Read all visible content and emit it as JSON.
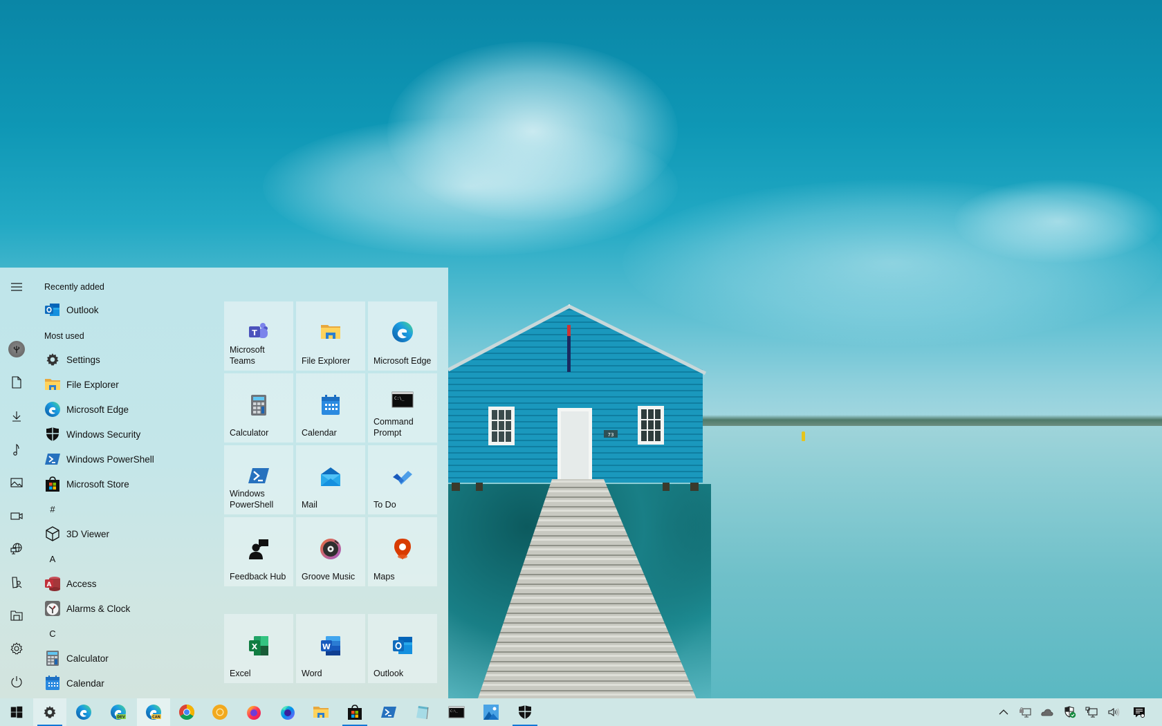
{
  "start_menu": {
    "rail": [
      {
        "name": "expand",
        "icon": "hamburger-icon"
      },
      {
        "name": "account",
        "icon": "avatar"
      },
      {
        "name": "documents",
        "icon": "document-icon"
      },
      {
        "name": "downloads",
        "icon": "download-icon"
      },
      {
        "name": "music",
        "icon": "music-note-icon"
      },
      {
        "name": "pictures",
        "icon": "picture-icon"
      },
      {
        "name": "videos",
        "icon": "video-icon"
      },
      {
        "name": "network",
        "icon": "network-globe-icon"
      },
      {
        "name": "personal-folder",
        "icon": "personal-folder-icon"
      },
      {
        "name": "file-explorer",
        "icon": "file-explorer-icon"
      },
      {
        "name": "settings",
        "icon": "gear-icon"
      },
      {
        "name": "power",
        "icon": "power-icon"
      }
    ],
    "app_list": {
      "recently_added_header": "Recently added",
      "recently_added": [
        {
          "label": "Outlook",
          "icon": "outlook-icon"
        }
      ],
      "most_used_header": "Most used",
      "most_used": [
        {
          "label": "Settings",
          "icon": "gear-icon"
        },
        {
          "label": "File Explorer",
          "icon": "file-explorer-icon"
        },
        {
          "label": "Microsoft Edge",
          "icon": "edge-icon"
        },
        {
          "label": "Windows Security",
          "icon": "shield-icon"
        },
        {
          "label": "Windows PowerShell",
          "icon": "powershell-icon"
        },
        {
          "label": "Microsoft Store",
          "icon": "store-icon"
        }
      ],
      "sections": [
        {
          "letter": "#",
          "items": [
            {
              "label": "3D Viewer",
              "icon": "cube-icon"
            }
          ]
        },
        {
          "letter": "A",
          "items": [
            {
              "label": "Access",
              "icon": "access-icon"
            },
            {
              "label": "Alarms & Clock",
              "icon": "clock-icon"
            }
          ]
        },
        {
          "letter": "C",
          "items": [
            {
              "label": "Calculator",
              "icon": "calculator-icon"
            },
            {
              "label": "Calendar",
              "icon": "calendar-icon"
            }
          ]
        }
      ]
    },
    "tiles": {
      "group1": [
        {
          "label": "Microsoft Teams",
          "icon": "teams-icon"
        },
        {
          "label": "File Explorer",
          "icon": "file-explorer-icon"
        },
        {
          "label": "Microsoft Edge",
          "icon": "edge-icon"
        },
        {
          "label": "Calculator",
          "icon": "calculator-icon"
        },
        {
          "label": "Calendar",
          "icon": "calendar-icon"
        },
        {
          "label": "Command Prompt",
          "icon": "command-prompt-icon"
        },
        {
          "label": "Windows PowerShell",
          "icon": "powershell-icon"
        },
        {
          "label": "Mail",
          "icon": "mail-icon"
        },
        {
          "label": "To Do",
          "icon": "todo-check-icon"
        },
        {
          "label": "Feedback Hub",
          "icon": "feedback-hub-icon"
        },
        {
          "label": "Groove Music",
          "icon": "groove-music-icon"
        },
        {
          "label": "Maps",
          "icon": "maps-pin-icon"
        }
      ],
      "group2": [
        {
          "label": "Excel",
          "icon": "excel-icon"
        },
        {
          "label": "Word",
          "icon": "word-icon"
        },
        {
          "label": "Outlook",
          "icon": "outlook-icon"
        }
      ]
    }
  },
  "taskbar": {
    "start_button": "windows-logo-icon",
    "apps": [
      {
        "name": "Settings",
        "icon": "gear-icon",
        "state": "active"
      },
      {
        "name": "Microsoft Edge",
        "icon": "edge-icon"
      },
      {
        "name": "Microsoft Edge Dev",
        "icon": "edge-dev-icon",
        "badge": "DEV"
      },
      {
        "name": "Microsoft Edge Canary",
        "icon": "edge-canary-icon",
        "badge": "CAN",
        "state": "hover"
      },
      {
        "name": "Google Chrome",
        "icon": "chrome-icon"
      },
      {
        "name": "Google Chrome Canary",
        "icon": "chrome-canary-icon"
      },
      {
        "name": "Firefox",
        "icon": "firefox-icon"
      },
      {
        "name": "Firefox Developer Edition",
        "icon": "firefox-dev-icon"
      },
      {
        "name": "File Explorer",
        "icon": "file-explorer-icon"
      },
      {
        "name": "Microsoft Store",
        "icon": "store-icon",
        "state": "running"
      },
      {
        "name": "Windows PowerShell",
        "icon": "powershell-icon"
      },
      {
        "name": "Notepad",
        "icon": "notepad-icon"
      },
      {
        "name": "Command Prompt",
        "icon": "command-prompt-icon"
      },
      {
        "name": "Photos",
        "icon": "photos-icon"
      },
      {
        "name": "Windows Security",
        "icon": "shield-icon",
        "state": "running"
      }
    ],
    "tray": [
      {
        "name": "show-hidden-icons",
        "icon": "chevron-up-icon"
      },
      {
        "name": "vpn",
        "icon": "vpn-lock-icon"
      },
      {
        "name": "onedrive",
        "icon": "cloud-icon"
      },
      {
        "name": "windows-security",
        "icon": "security-check-icon"
      },
      {
        "name": "network",
        "icon": "ethernet-icon"
      },
      {
        "name": "volume",
        "icon": "speaker-icon"
      },
      {
        "name": "action-center",
        "icon": "notification-icon"
      }
    ],
    "badges": {
      "dev": "DEV",
      "can": "CAN"
    }
  },
  "colors": {
    "accent": "#1277d6",
    "start_bg": "#c4e6e9",
    "taskbar_bg": "#cfe7e6"
  },
  "wallpaper": {
    "house_sign": "73"
  }
}
